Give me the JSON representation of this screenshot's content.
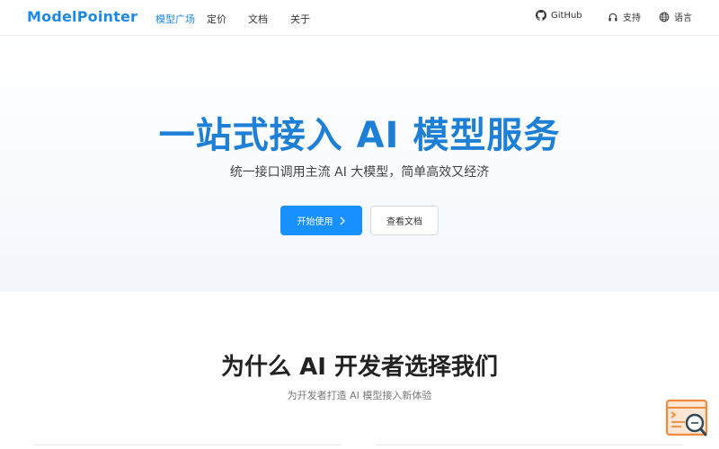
{
  "header": {
    "logo": "ModelPointer",
    "nav": [
      "模型广场",
      "定价",
      "文档",
      "关于"
    ],
    "github_label": "GitHub",
    "support_label": "支持",
    "lang_label": "语言"
  },
  "hero": {
    "title": "一站式接入 AI 模型服务",
    "subtitle": "统一接口调用主流 AI 大模型，简单高效又经济",
    "primary_button": "开始使用",
    "secondary_button": "查看文档"
  },
  "section": {
    "title": "为什么 AI 开发者选择我们",
    "subtitle": "为开发者打造 AI 模型接入新体验"
  },
  "colors": {
    "brand": "#1e88e5",
    "primary_button": "#1890ff"
  }
}
